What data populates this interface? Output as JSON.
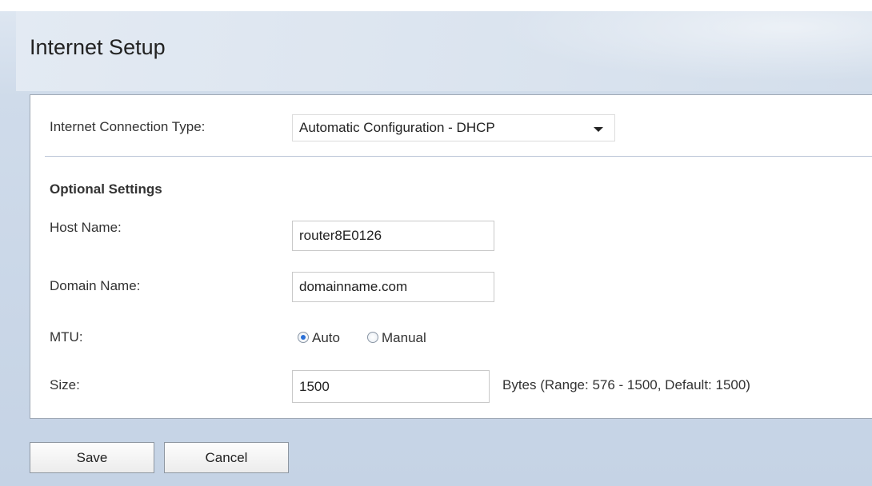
{
  "header": {
    "title": "Internet Setup"
  },
  "connection": {
    "label": "Internet Connection Type:",
    "selected": "Automatic Configuration - DHCP"
  },
  "optional": {
    "heading": "Optional Settings",
    "host_name": {
      "label": "Host Name:",
      "value": "router8E0126"
    },
    "domain_name": {
      "label": "Domain Name:",
      "value": "domainname.com"
    },
    "mtu": {
      "label": "MTU:",
      "options": [
        {
          "label": "Auto",
          "checked": true
        },
        {
          "label": "Manual",
          "checked": false
        }
      ]
    },
    "size": {
      "label": "Size:",
      "value": "1500",
      "hint": "Bytes (Range: 576 - 1500, Default: 1500)"
    }
  },
  "actions": {
    "save_label": "Save",
    "cancel_label": "Cancel"
  },
  "colors": {
    "background": "#c5d3e5",
    "panel": "#ffffff",
    "radio_selected": "#2a6fd6"
  }
}
